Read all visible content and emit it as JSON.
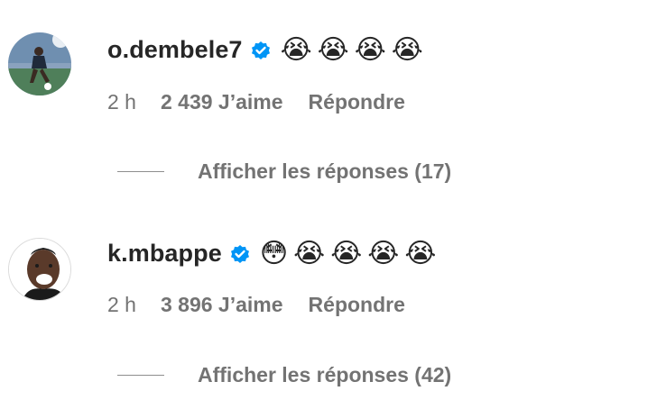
{
  "comments": [
    {
      "username": "o.dembele7",
      "emojis": [
        "😭",
        "😭",
        "😭",
        "😭"
      ],
      "time": "2 h",
      "likes": "2 439 J’aime",
      "reply_label": "Répondre",
      "view_replies": "Afficher les réponses (17)"
    },
    {
      "username": "k.mbappe",
      "emojis": [
        "😳",
        "😭",
        "😭",
        "😭",
        "😭"
      ],
      "time": "2 h",
      "likes": "3 896 J’aime",
      "reply_label": "Répondre",
      "view_replies": "Afficher les réponses (42)"
    }
  ],
  "colors": {
    "verified": "#0095f6",
    "secondary_text": "#737373",
    "primary_text": "#262626"
  },
  "icons": {
    "verified": "verified-badge-icon",
    "avatar1": "user-avatar",
    "avatar2": "user-avatar"
  }
}
